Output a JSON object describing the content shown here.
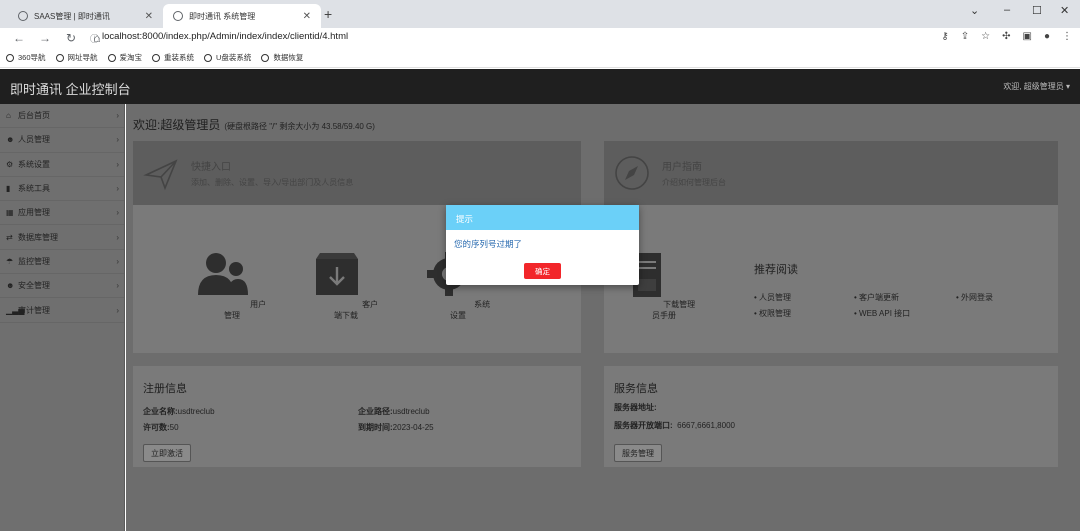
{
  "browser": {
    "tabs": [
      {
        "title": "SAAS管理 | 即时通讯",
        "active": false
      },
      {
        "title": "即时通讯 系统管理",
        "active": true
      }
    ],
    "new_tab": "+",
    "url": "localhost:8000/index.php/Admin/index/index/clientid/4.html",
    "bookmarks": [
      "360导航",
      "网址导航",
      "爱淘宝",
      "重装系统",
      "U盘装系统",
      "数据恢复"
    ]
  },
  "app": {
    "brand": "即时通讯 企业控制台",
    "user_menu": "欢迎, 超级管理员 ▾"
  },
  "sidebar": {
    "items": [
      {
        "label": "后台首页",
        "icon": "home-icon"
      },
      {
        "label": "人员管理",
        "icon": "users-icon"
      },
      {
        "label": "系统设置",
        "icon": "gears-icon"
      },
      {
        "label": "系统工具",
        "icon": "toolbox-icon"
      },
      {
        "label": "应用管理",
        "icon": "grid-icon"
      },
      {
        "label": "数据库管理",
        "icon": "exchange-icon"
      },
      {
        "label": "监控管理",
        "icon": "umbrella-icon"
      },
      {
        "label": "安全管理",
        "icon": "shield-users-icon"
      },
      {
        "label": "审计管理",
        "icon": "bar-chart-icon"
      }
    ]
  },
  "main": {
    "welcome_title": "欢迎:超级管理员",
    "disk_info": "(硬盘根路径 \"/\" 剩余大小为 43.58/59.40 G)",
    "quick": {
      "title": "快捷入口",
      "subtitle": "添加、删除、设置、导入/导出部门及人员信息",
      "items": [
        "用户管理",
        "客户端下载",
        "系统设置"
      ]
    },
    "guide": {
      "title": "用户指南",
      "subtitle": "介绍如何管理后台",
      "download_label": "下载管理员手册",
      "reading_title": "推荐阅读",
      "links": [
        "人员管理",
        "客户端更新",
        "外网登录",
        "权限管理",
        "WEB API 接口"
      ]
    },
    "register": {
      "title": "注册信息",
      "company_name_label": "企业名称:",
      "company_name": "usdtreclub",
      "company_path_label": "企业路径:",
      "company_path": "usdtreclub",
      "license_label": "许可数:",
      "license": "50",
      "expire_label": "到期时间:",
      "expire": "2023-04-25",
      "activate_btn": "立即激活"
    },
    "service": {
      "title": "服务信息",
      "address_label": "服务器地址:",
      "ports_label": "服务器开放端口:",
      "ports": "6667,6661,8000",
      "manage_btn": "服务管理"
    }
  },
  "modal": {
    "title": "提示",
    "message": "您的序列号过期了",
    "ok": "确定",
    "colors": {
      "header": "#6bd0f8",
      "button": "#f2262a"
    }
  }
}
